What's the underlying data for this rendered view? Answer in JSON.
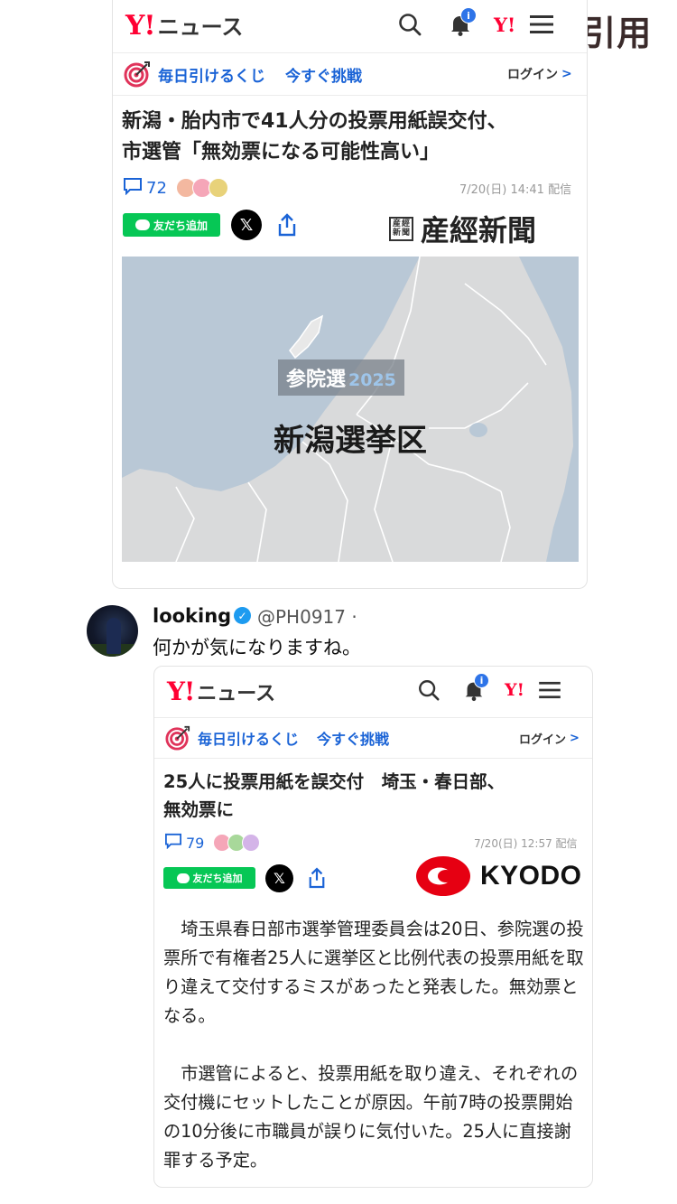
{
  "quote_label": "X引用",
  "article1": {
    "header": {
      "logo": "Y!",
      "app_name": "ニュース",
      "notification_badge": "i",
      "yahoo_small": "Y!"
    },
    "kuji": {
      "label": "毎日引けるくじ",
      "cta": "今すぐ挑戦",
      "login": "ログイン",
      "chevron": ">"
    },
    "headline_line1": "新潟・胎内市で41人分の投票用紙誤交付、",
    "headline_line2": "市選管「無効票になる可能性高い」",
    "comments": "72",
    "date": "7/20(日) 14:41 配信",
    "line_button": "友だち追加",
    "publisher": "産經新聞",
    "publisher_seal": [
      "産",
      "經",
      "新",
      "聞"
    ],
    "map": {
      "tag": "参院選",
      "tag_year": "2025",
      "title": "新潟選挙区"
    }
  },
  "tweet": {
    "name": "looking",
    "handle": "@PH0917 ·",
    "text": "何かが気になりますね。"
  },
  "article2": {
    "header": {
      "logo": "Y!",
      "app_name": "ニュース",
      "notification_badge": "i",
      "yahoo_small": "Y!"
    },
    "kuji": {
      "label": "毎日引けるくじ",
      "cta": "今すぐ挑戦",
      "login": "ログイン",
      "chevron": ">"
    },
    "headline_line1": "25人に投票用紙を誤交付　埼玉・春日部、",
    "headline_line2": "無効票に",
    "comments": "79",
    "date": "7/20(日) 12:57 配信",
    "line_button": "友だち追加",
    "publisher": "KYODO",
    "body": [
      "埼玉県春日部市選挙管理委員会は20日、参院選の投票所で有権者25人に選挙区と比例代表の投票用紙を取り違えて交付するミスがあったと発表した。無効票となる。",
      "市選管によると、投票用紙を取り違え、それぞれの交付機にセットしたことが原因。午前7時の投票開始の10分後に市職員が誤りに気付いた。25人に直接謝罪する予定。"
    ]
  },
  "colors": {
    "yahoo_red": "#ff0033",
    "link_blue": "#1a63d6",
    "line_green": "#06c755",
    "kyodo_red": "#e60012"
  }
}
